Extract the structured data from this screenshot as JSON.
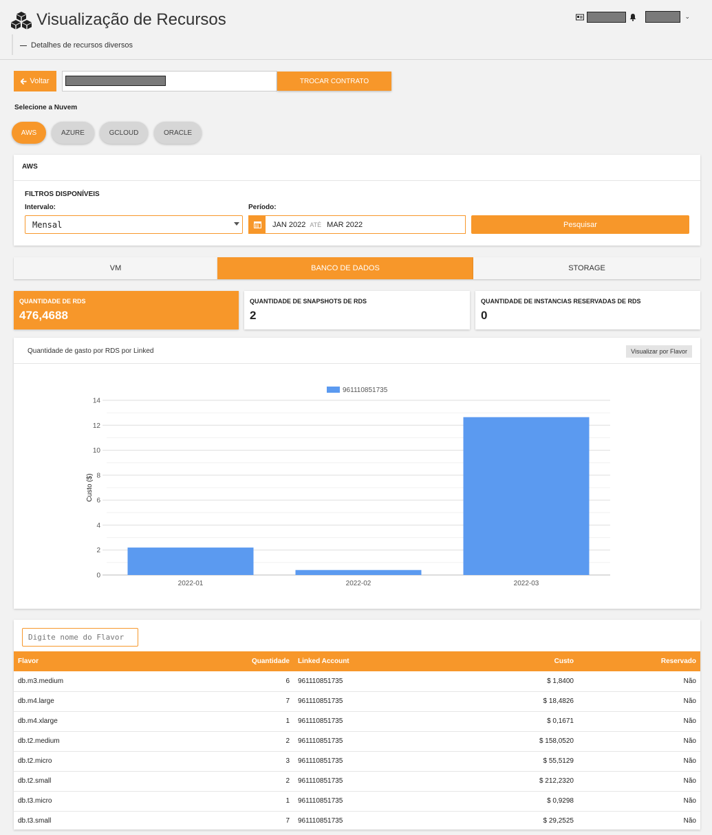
{
  "header": {
    "title": "Visualização de Recursos",
    "subtitle": "Detalhes de recursos diversos"
  },
  "contract": {
    "back_label": "Voltar",
    "switch_label": "TROCAR CONTRATO"
  },
  "clouds": {
    "label": "Selecione a Nuvem",
    "items": [
      "AWS",
      "AZURE",
      "GCLOUD",
      "ORACLE"
    ],
    "active": "AWS"
  },
  "filters": {
    "card_title": "AWS",
    "section_title": "FILTROS DISPONÍVEIS",
    "interval_label": "Intervalo:",
    "interval_value": "Mensal",
    "period_label": "Período:",
    "period_start": "JAN 2022",
    "period_sep": "ATÉ",
    "period_end": "MAR 2022",
    "search_label": "Pesquisar"
  },
  "tabs": [
    "VM",
    "BANCO DE DADOS",
    "STORAGE"
  ],
  "stats": [
    {
      "label": "QUANTIDADE DE RDS",
      "value": "476,4688"
    },
    {
      "label": "QUANTIDADE DE SNAPSHOTS DE RDS",
      "value": "2"
    },
    {
      "label": "QUANTIDADE DE INSTANCIAS RESERVADAS DE RDS",
      "value": "0"
    }
  ],
  "chart": {
    "title": "Quantidade de gasto por RDS por Linked",
    "flavor_button": "Visualizar por Flavor"
  },
  "chart_data": {
    "type": "bar",
    "categories": [
      "2022-01",
      "2022-02",
      "2022-03"
    ],
    "series": [
      {
        "name": "961110851735",
        "values": [
          2.2,
          0.4,
          12.65
        ],
        "color": "#5b9af0"
      }
    ],
    "ylabel": "Custo ($)",
    "xlabel": "",
    "ylim": [
      0,
      14
    ],
    "yticks": [
      0,
      2,
      4,
      6,
      8,
      10,
      12,
      14
    ],
    "grid": true,
    "legend": "top-center"
  },
  "table": {
    "filter_placeholder": "Digite nome do Flavor",
    "columns": [
      "Flavor",
      "Quantidade",
      "Linked Account",
      "Custo",
      "Reservado"
    ],
    "rows": [
      [
        "db.m3.medium",
        "6",
        "961110851735",
        "$ 1,8400",
        "Não"
      ],
      [
        "db.m4.large",
        "7",
        "961110851735",
        "$ 18,4826",
        "Não"
      ],
      [
        "db.m4.xlarge",
        "1",
        "961110851735",
        "$ 0,1671",
        "Não"
      ],
      [
        "db.t2.medium",
        "2",
        "961110851735",
        "$ 158,0520",
        "Não"
      ],
      [
        "db.t2.micro",
        "3",
        "961110851735",
        "$ 55,5129",
        "Não"
      ],
      [
        "db.t2.small",
        "2",
        "961110851735",
        "$ 212,2320",
        "Não"
      ],
      [
        "db.t3.micro",
        "1",
        "961110851735",
        "$ 0,9298",
        "Não"
      ],
      [
        "db.t3.small",
        "7",
        "961110851735",
        "$ 29,2525",
        "Não"
      ]
    ]
  },
  "colors": {
    "accent": "#f7972a",
    "bar": "#5b9af0"
  }
}
